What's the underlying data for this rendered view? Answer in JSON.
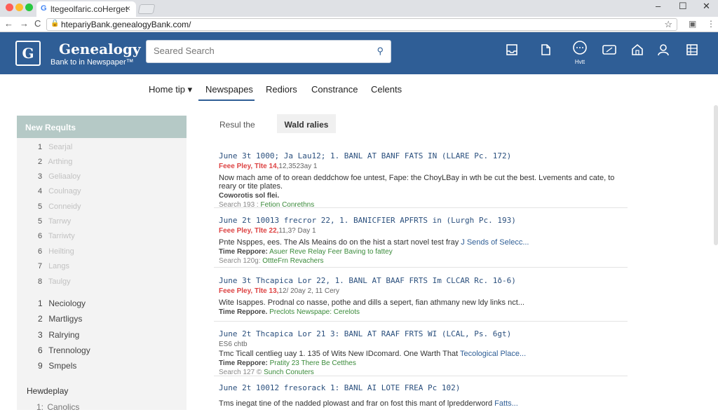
{
  "browser": {
    "tab_title": "ltegeolfaric.coHerget",
    "tab_close": "×",
    "url": "htepariyBank.genealogyBank.com/",
    "window_controls": [
      "–",
      "☐",
      "✕"
    ],
    "nav_buttons": [
      "←",
      "→",
      "C"
    ],
    "colors": {
      "dot_red": "#ff5f57",
      "dot_yellow": "#febc2e",
      "dot_green": "#28c840"
    }
  },
  "header": {
    "logo_glyph": "G",
    "brand": "Genealogy",
    "tagline": "Bank to in Newspaper™",
    "search_placeholder": "Seared Search",
    "icons": [
      "inbox-icon",
      "document-icon",
      "chat-icon",
      "card-icon",
      "home-icon",
      "user-icon",
      "grid-icon"
    ],
    "chat_label": "Hvtt",
    "accent_color": "#2f5e96"
  },
  "nav": {
    "items": [
      {
        "label": "Home tip ▾"
      },
      {
        "label": "Newspapes"
      },
      {
        "label": "Rediors"
      },
      {
        "label": "Constrance"
      },
      {
        "label": "Celents"
      }
    ]
  },
  "sidebar": {
    "heading": "New Reqults",
    "faded_items": [
      {
        "num": "1",
        "label": "Searjal"
      },
      {
        "num": "2",
        "label": "Arthing"
      },
      {
        "num": "3",
        "label": "Geliaaloy"
      },
      {
        "num": "4",
        "label": "Coulnagy"
      },
      {
        "num": "5",
        "label": "Conneidy"
      },
      {
        "num": "5",
        "label": "Tarrwy"
      },
      {
        "num": "6",
        "label": "Tarriwty"
      },
      {
        "num": "6",
        "label": "Heilting"
      },
      {
        "num": "7",
        "label": "Langs"
      },
      {
        "num": "8",
        "label": "Taulgy"
      }
    ],
    "items": [
      {
        "num": "1",
        "label": "Neciology"
      },
      {
        "num": "2",
        "label": "Martligys"
      },
      {
        "num": "3",
        "label": "Ralrying"
      },
      {
        "num": "6",
        "label": "Trennology"
      },
      {
        "num": "9",
        "label": "Smpels"
      }
    ],
    "section_heading": "Hewdeplay",
    "section_item": {
      "num": "1:",
      "label": "Canolics"
    }
  },
  "main": {
    "tabs": [
      {
        "label": "Resul the"
      },
      {
        "label": "Wald ralies"
      }
    ],
    "results": [
      {
        "title": "June 3t 1000; Ja Lau12; 1. BANL AT BANF FATS IN (LLARE Pc. 172)",
        "date_red": "Feee Pley, Tlte 14,",
        "date_rest": "12,3523ay 1",
        "desc": "Now mach ame of to orean deddchow foe untest, Fape: the ChoyLBay in wth be cut the best. Lvements and cate, to reary or tite plates.",
        "desc_link": "",
        "tag_label": "Coworotis sol flei.",
        "tag_value": "",
        "source_label": "Search 193 :",
        "source_value": "Fetion Conrethns"
      },
      {
        "title": "June 2t 10013 frecror 22, 1. BANICFIER APFRTS in (Lurgh Pc. 193)",
        "date_red": "Feee Pley, Tlte 22,",
        "date_rest": "11,3? Day 1",
        "desc": "Pnte Nsppes, ees. The Als Meains do on the hist a start novel test fray",
        "desc_link": "J Sends of Selecc...",
        "tag_label": "Time Reppore:",
        "tag_value": "Asuer Reve Relay Feer Baving to fattey",
        "source_label": "Search 120g:",
        "source_value": "OttteFrn Revachers"
      },
      {
        "title": "June 3t Thcapica Lor 22, 1. BANL AT BAAF FRTS Im CLCAR Rc. 1ð-6)",
        "date_red": "Feee Pley, Tlte 13,",
        "date_rest": "12/ 20ay 2, 11 Cery",
        "desc": "Wite Isappes. Prodnal co nasse, pothe and dills a sepert, fian athmany new ldy links nct...",
        "desc_link": "",
        "tag_label": "Time Reppore.",
        "tag_value": "Preclots Newspape: Cerelots",
        "source_label": "",
        "source_value": ""
      },
      {
        "title": "June 2t Thcapica Lor 21 3: BANL AT RAAF FRTS WI (LCAL, Ps. 6gt)",
        "date_red": "",
        "date_rest": "ES6 chtb",
        "desc": "Tmc Ticall centlieg uay 1. 135 of Wits New IDcomard. One Warth That",
        "desc_link": "Tecological Place...",
        "tag_label": "Time Reppore:",
        "tag_value": "Pratity 23 There Be Cetthes",
        "source_label": "Search 127 ©",
        "source_value": "Sunch Conuters"
      },
      {
        "title": "June 2t 10012 fresorack 1: BANL AI LOTE FREA Pc 102)",
        "date_red": "",
        "date_rest": "",
        "desc": "Tms inegat tine of the nadded plowast and frar on fost this mant of lpredderword",
        "desc_link": "Fatts...",
        "tag_label": "",
        "tag_value": "",
        "source_label": "",
        "source_value": ""
      }
    ]
  }
}
